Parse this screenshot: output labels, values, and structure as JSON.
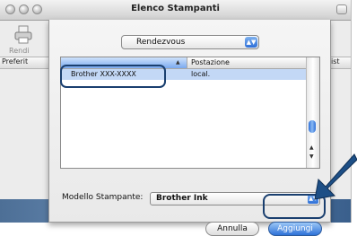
{
  "window": {
    "title": "Elenco Stampanti",
    "toolbar_label": "Rendi",
    "header_left": "Preferit",
    "header_right": "ist"
  },
  "sheet": {
    "browser_popup": {
      "selected": "Rendezvous"
    },
    "list": {
      "columns": [
        "",
        "Postazione"
      ],
      "rows": [
        {
          "name": "Brother  XXX-XXXX",
          "location": "local."
        }
      ]
    },
    "model_label": "Modello Stampante:",
    "model_value": "Brother Ink",
    "cancel_label": "Annulla",
    "add_label": "Aggiungi"
  },
  "colors": {
    "accent_blue": "#2c6ed8",
    "highlight_outline": "#1a3f6f",
    "selection_row": "#c3d8f6"
  },
  "icons": {
    "printer": "printer-icon",
    "pointer": "arrow-pointer-icon"
  }
}
